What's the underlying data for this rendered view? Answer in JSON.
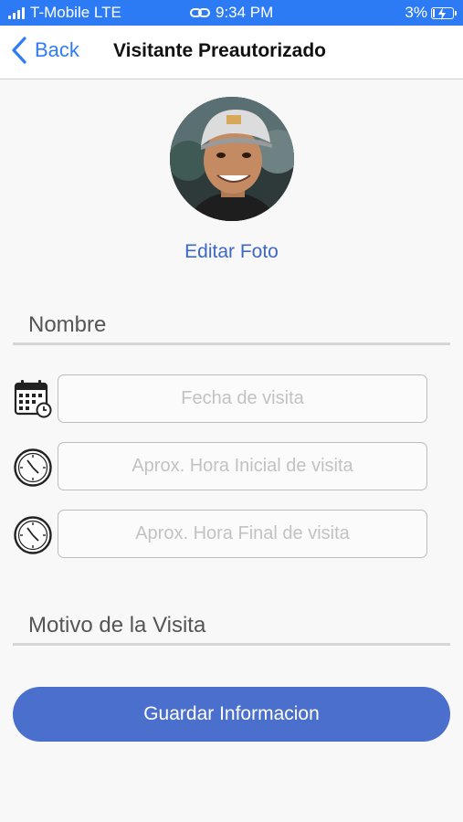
{
  "status_bar": {
    "carrier": "T-Mobile LTE",
    "time": "9:34 PM",
    "battery_percent": "3%",
    "battery_level": 0.03,
    "signal_bars": 4
  },
  "nav": {
    "back_label": "Back",
    "title": "Visitante Preautorizado"
  },
  "profile": {
    "edit_photo_label": "Editar Foto"
  },
  "form": {
    "name_placeholder": "Nombre",
    "visit_date_placeholder": "Fecha de visita",
    "start_time_placeholder": "Aprox. Hora Inicial de visita",
    "end_time_placeholder": "Aprox. Hora Final de visita",
    "reason_placeholder": "Motivo de la Visita",
    "save_label": "Guardar Informacion"
  },
  "colors": {
    "status_bar": "#2d7bf4",
    "link": "#2f7cf6",
    "accent": "#4a6fcc"
  },
  "icons": {
    "back": "chevron-left-icon",
    "date": "calendar-icon",
    "start_time": "clock-icon",
    "end_time": "clock-icon"
  }
}
